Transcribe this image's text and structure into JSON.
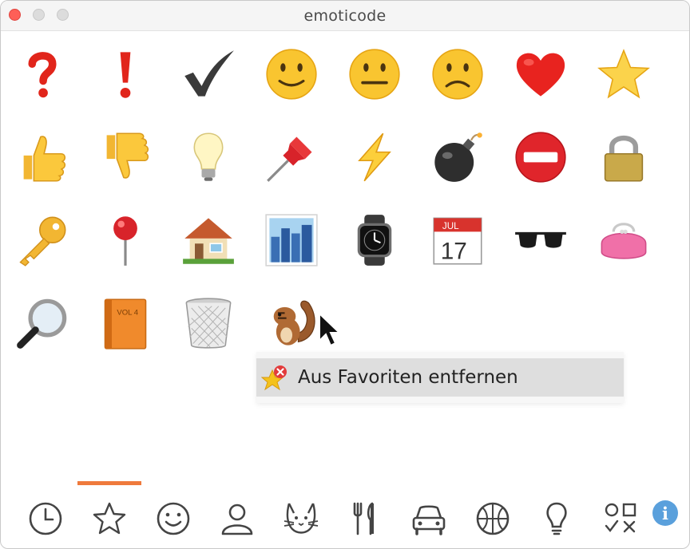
{
  "window": {
    "title": "emoticode",
    "controls": [
      "close-button",
      "minimize-button",
      "zoom-button"
    ]
  },
  "emoji_grid": {
    "rows": [
      [
        "question-mark",
        "exclamation-mark",
        "check-mark",
        "slightly-smiling-face",
        "neutral-face",
        "slightly-frowning-face",
        "red-heart",
        "star"
      ],
      [
        "thumbs-up",
        "thumbs-down",
        "light-bulb",
        "pushpin",
        "high-voltage",
        "bomb",
        "no-entry",
        "locked"
      ],
      [
        "key",
        "round-pushpin",
        "house",
        "cityscape",
        "watch",
        "calendar",
        "sunglasses",
        "purse"
      ],
      [
        "magnifying-glass",
        "orange-book",
        "wastebasket",
        "chipmunk"
      ]
    ],
    "book_label": "VOL 4",
    "calendar_month": "JUL",
    "calendar_day": "17"
  },
  "context_menu": {
    "items": [
      {
        "label": "Aus Favoriten entfernen",
        "icon": "star-remove-icon"
      }
    ]
  },
  "tabs": {
    "items": [
      {
        "icon": "clock-icon"
      },
      {
        "icon": "star-icon"
      },
      {
        "icon": "smiley-icon"
      },
      {
        "icon": "person-icon"
      },
      {
        "icon": "cat-icon"
      },
      {
        "icon": "fork-knife-icon"
      },
      {
        "icon": "car-icon"
      },
      {
        "icon": "basketball-icon"
      },
      {
        "icon": "lightbulb-icon"
      },
      {
        "icon": "symbols-icon"
      }
    ],
    "selected_index": 1,
    "indicator_color": "#ef7a3c"
  },
  "info_button": {
    "label": "i",
    "color": "#5aa0dc"
  }
}
